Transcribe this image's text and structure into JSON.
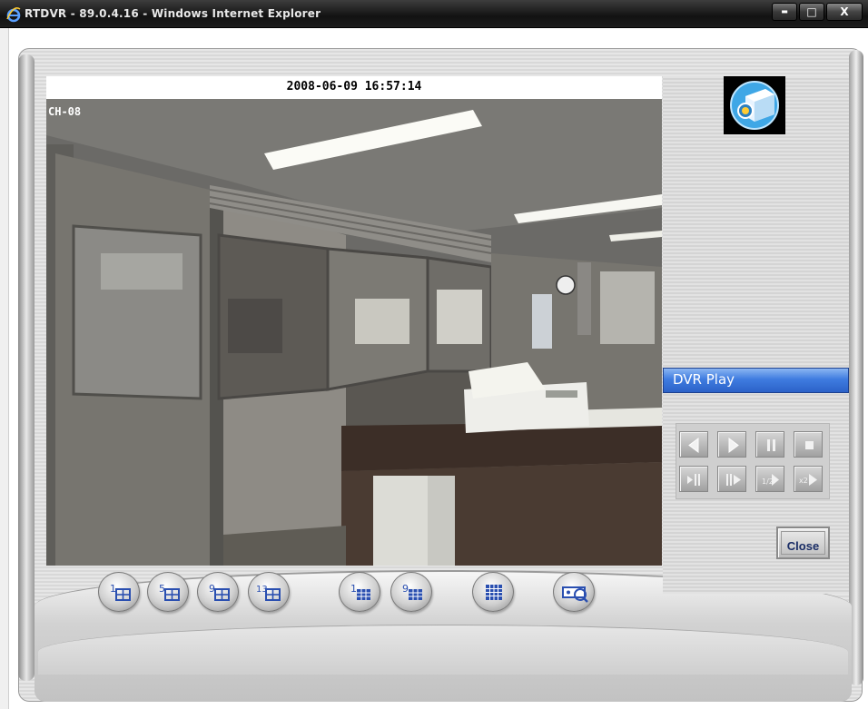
{
  "window": {
    "title": "RTDVR - 89.0.4.16 - Windows Internet Explorer",
    "min_glyph": "▬",
    "max_glyph": "□",
    "close_glyph": "X"
  },
  "video": {
    "timestamp": "2008-06-09 16:57:14",
    "channel": "CH-08"
  },
  "panel": {
    "mode_label": "DVR Play",
    "close_label": "Close"
  },
  "playback_controls": [
    {
      "name": "rewind-button",
      "icon": "play-reverse-icon"
    },
    {
      "name": "play-button",
      "icon": "play-icon"
    },
    {
      "name": "pause-button",
      "icon": "pause-icon"
    },
    {
      "name": "stop-button",
      "icon": "stop-icon"
    },
    {
      "name": "step-back-button",
      "icon": "step-back-icon"
    },
    {
      "name": "step-forward-button",
      "icon": "step-forward-icon"
    },
    {
      "name": "slow-play-button",
      "icon": "slow-play-icon"
    },
    {
      "name": "fast-forward-button",
      "icon": "fast-forward-icon"
    }
  ],
  "layout_buttons": [
    {
      "name": "layout-1-button",
      "number": "1"
    },
    {
      "name": "layout-5-button",
      "number": "5"
    },
    {
      "name": "layout-9-button",
      "number": "9"
    },
    {
      "name": "layout-13-button",
      "number": "13"
    },
    {
      "name": "layout-1b-button",
      "number": "1"
    },
    {
      "name": "layout-9b-button",
      "number": "9"
    },
    {
      "name": "layout-grid-button",
      "number": ""
    },
    {
      "name": "search-button",
      "number": ""
    }
  ],
  "colors": {
    "accent_blue": "#3f7ce0",
    "icon_blue": "#2a4fb0"
  }
}
